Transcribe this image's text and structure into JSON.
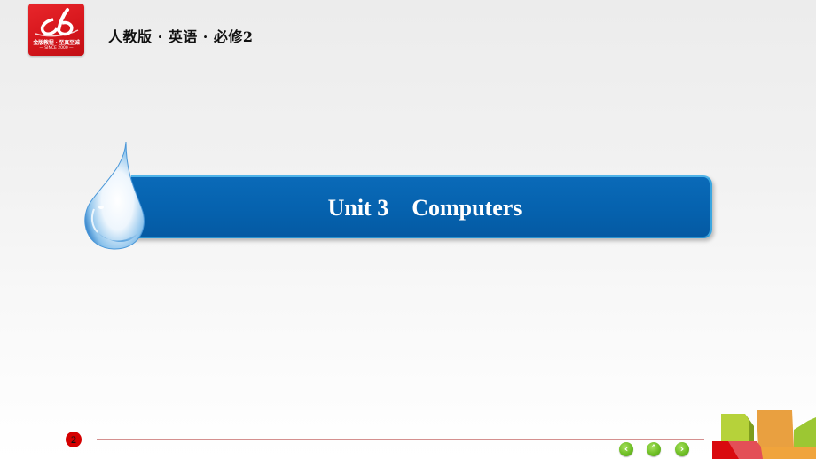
{
  "header": {
    "logo": {
      "motto": "金版教程 · 至真至诚",
      "since": "— SINCE 2000 —",
      "brand_color": "#d6161c"
    },
    "book_title": "人教版 · 英语 · 必修2"
  },
  "banner": {
    "title": "Unit 3    Computers",
    "color": "#0561ad",
    "icon": "water-droplet-icon"
  },
  "footer": {
    "page_number": "2",
    "nav": {
      "prev_label": "‹",
      "home_label": "˄",
      "next_label": "›",
      "color": "#6fbf26"
    },
    "decoration": "colored-blocks"
  }
}
